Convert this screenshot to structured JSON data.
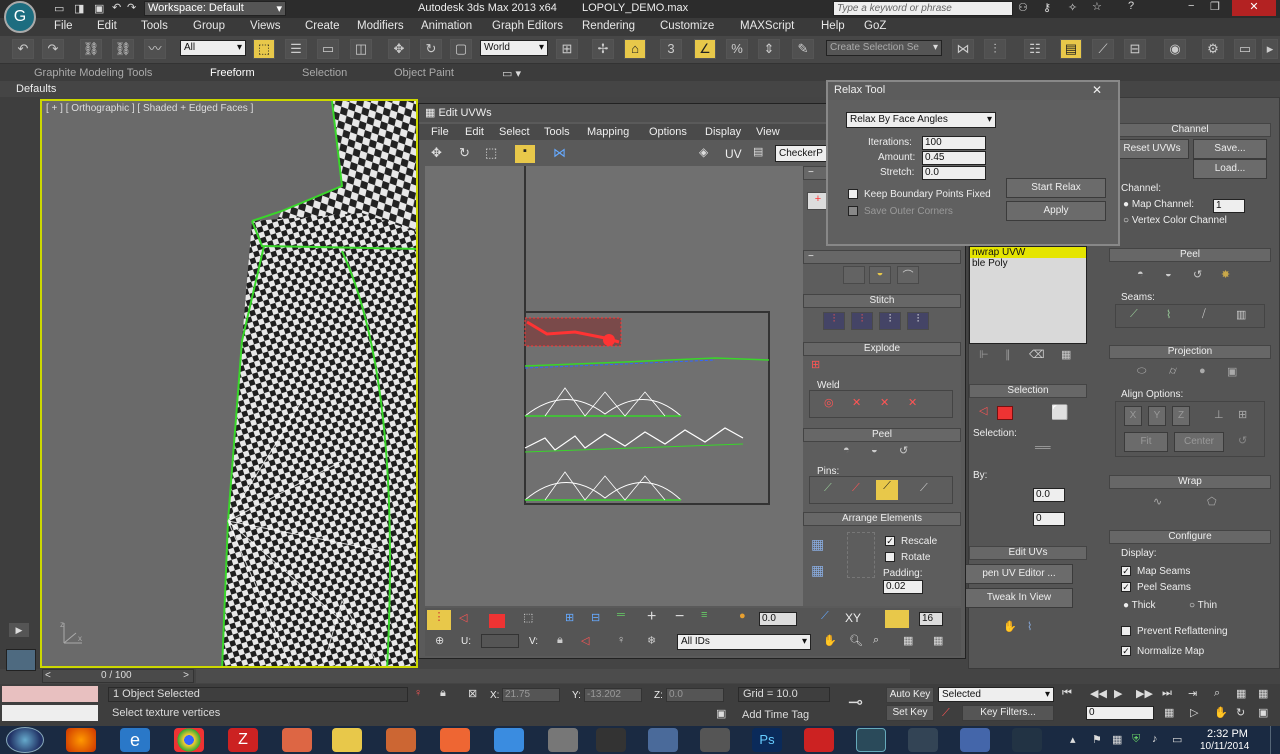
{
  "title": {
    "workspace": "Workspace: Default",
    "app": "Autodesk 3ds Max  2013 x64",
    "file": "LOPOLY_DEMO.max",
    "search_placeholder": "Type a keyword or phrase"
  },
  "menu": [
    "File",
    "Edit",
    "Tools",
    "Group",
    "Views",
    "Create",
    "Modifiers",
    "Animation",
    "Graph Editors",
    "Rendering",
    "Customize",
    "MAXScript",
    "Help",
    "GoZ"
  ],
  "toolbar": {
    "filter": "All",
    "coord": "World",
    "selection_set_placeholder": "Create Selection Se"
  },
  "ribbon": {
    "tabs": [
      "Graphite Modeling Tools",
      "Freeform",
      "Selection",
      "Object Paint"
    ],
    "active": "Freeform",
    "defaults": "Defaults"
  },
  "viewport": {
    "label": "[ + ] [ Orthographic ] [ Shaded + Edged Faces ]"
  },
  "edit_uvws": {
    "title": "Edit UVWs",
    "menu": [
      "File",
      "Edit",
      "Select",
      "Tools",
      "Mapping",
      "Options",
      "Display",
      "View"
    ],
    "uv_label": "UV",
    "map_dropdown": "CheckerP",
    "stitch": "Stitch",
    "explode": "Explode",
    "weld": "Weld",
    "peel": "Peel",
    "pins": "Pins:",
    "arrange": "Arrange Elements",
    "rescale": "Rescale",
    "rotate": "Rotate",
    "padding_label": "Padding:",
    "padding": "0.02",
    "u_label": "U:",
    "v_label": "V:",
    "ids": "All IDs",
    "xy": "XY",
    "val1": "0.0",
    "val2": "16"
  },
  "relax": {
    "title": "Relax Tool",
    "mode": "Relax By Face Angles",
    "iterations_label": "Iterations:",
    "iterations": "100",
    "amount_label": "Amount:",
    "amount": "0.45",
    "stretch_label": "Stretch:",
    "stretch": "0.0",
    "keep_boundary": "Keep Boundary Points Fixed",
    "save_corners": "Save Outer Corners",
    "start": "Start Relax",
    "apply": "Apply"
  },
  "right_panel": {
    "channel": "Channel",
    "reset": "Reset UVWs",
    "save": "Save...",
    "load": "Load...",
    "channel_label": "Channel:",
    "map_channel": "Map Channel:",
    "map_channel_value": "1",
    "vertex_color": "Vertex Color Channel",
    "stack_top": "nwrap UVW",
    "stack_bottom": "ble Poly",
    "peel": "Peel",
    "seams": "Seams:",
    "projection": "Projection",
    "align": "Align Options:",
    "fit": "Fit",
    "center": "Center",
    "selection": "Selection",
    "selection_sub": "Selection:",
    "by": "By:",
    "v1": "0.0",
    "v2": "0",
    "edit_uvs": "Edit UVs",
    "open_editor": "pen UV Editor ...",
    "tweak": "Tweak In View",
    "wrap": "Wrap",
    "configure": "Configure",
    "display": "Display:",
    "map_seams": "Map Seams",
    "peel_seams": "Peel Seams",
    "thick": "Thick",
    "thin": "Thin",
    "prevent": "Prevent Reflattening",
    "normalize": "Normalize Map"
  },
  "timeline": {
    "frame": "0 / 100"
  },
  "status": {
    "selected": "1 Object Selected",
    "prompt": "Select texture vertices",
    "x": "21.75",
    "y": "-13.202",
    "z": "0.0",
    "grid": "Grid = 10.0",
    "add_time_tag": "Add Time Tag",
    "autokey": "Auto Key",
    "setkey": "Set Key",
    "selected_dd": "Selected",
    "key_filters": "Key Filters...",
    "frame_field": "0"
  },
  "clock": {
    "time": "2:32 PM",
    "date": "10/11/2014"
  },
  "colors": {
    "accent_yellow": "#ccd800",
    "selection_green": "#39d62a",
    "uv_white": "#ffffff",
    "red_selection": "#ff2020"
  }
}
